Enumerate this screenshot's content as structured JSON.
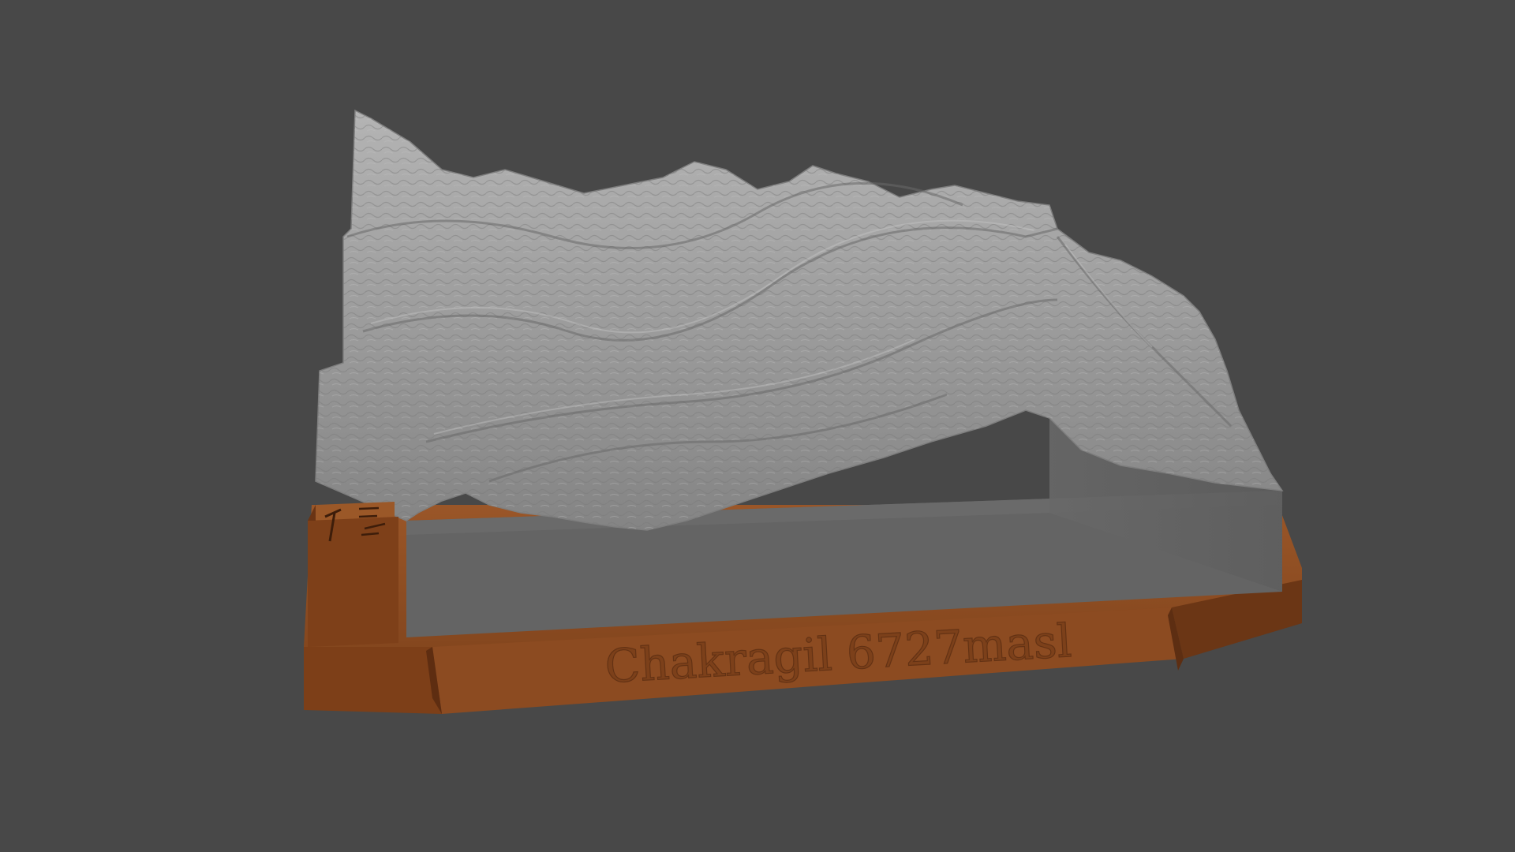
{
  "scene": {
    "background_color": "#484848",
    "model": {
      "terrain_color": "#8f8f8f",
      "terrain_shadow": "#6f6f6f",
      "base_color": "#8a4a20",
      "base_dark": "#6a3615",
      "label_text": "Chakragil 6727masl",
      "badge_icons": [
        "ice-axe-icon",
        "sign-icon"
      ]
    }
  }
}
